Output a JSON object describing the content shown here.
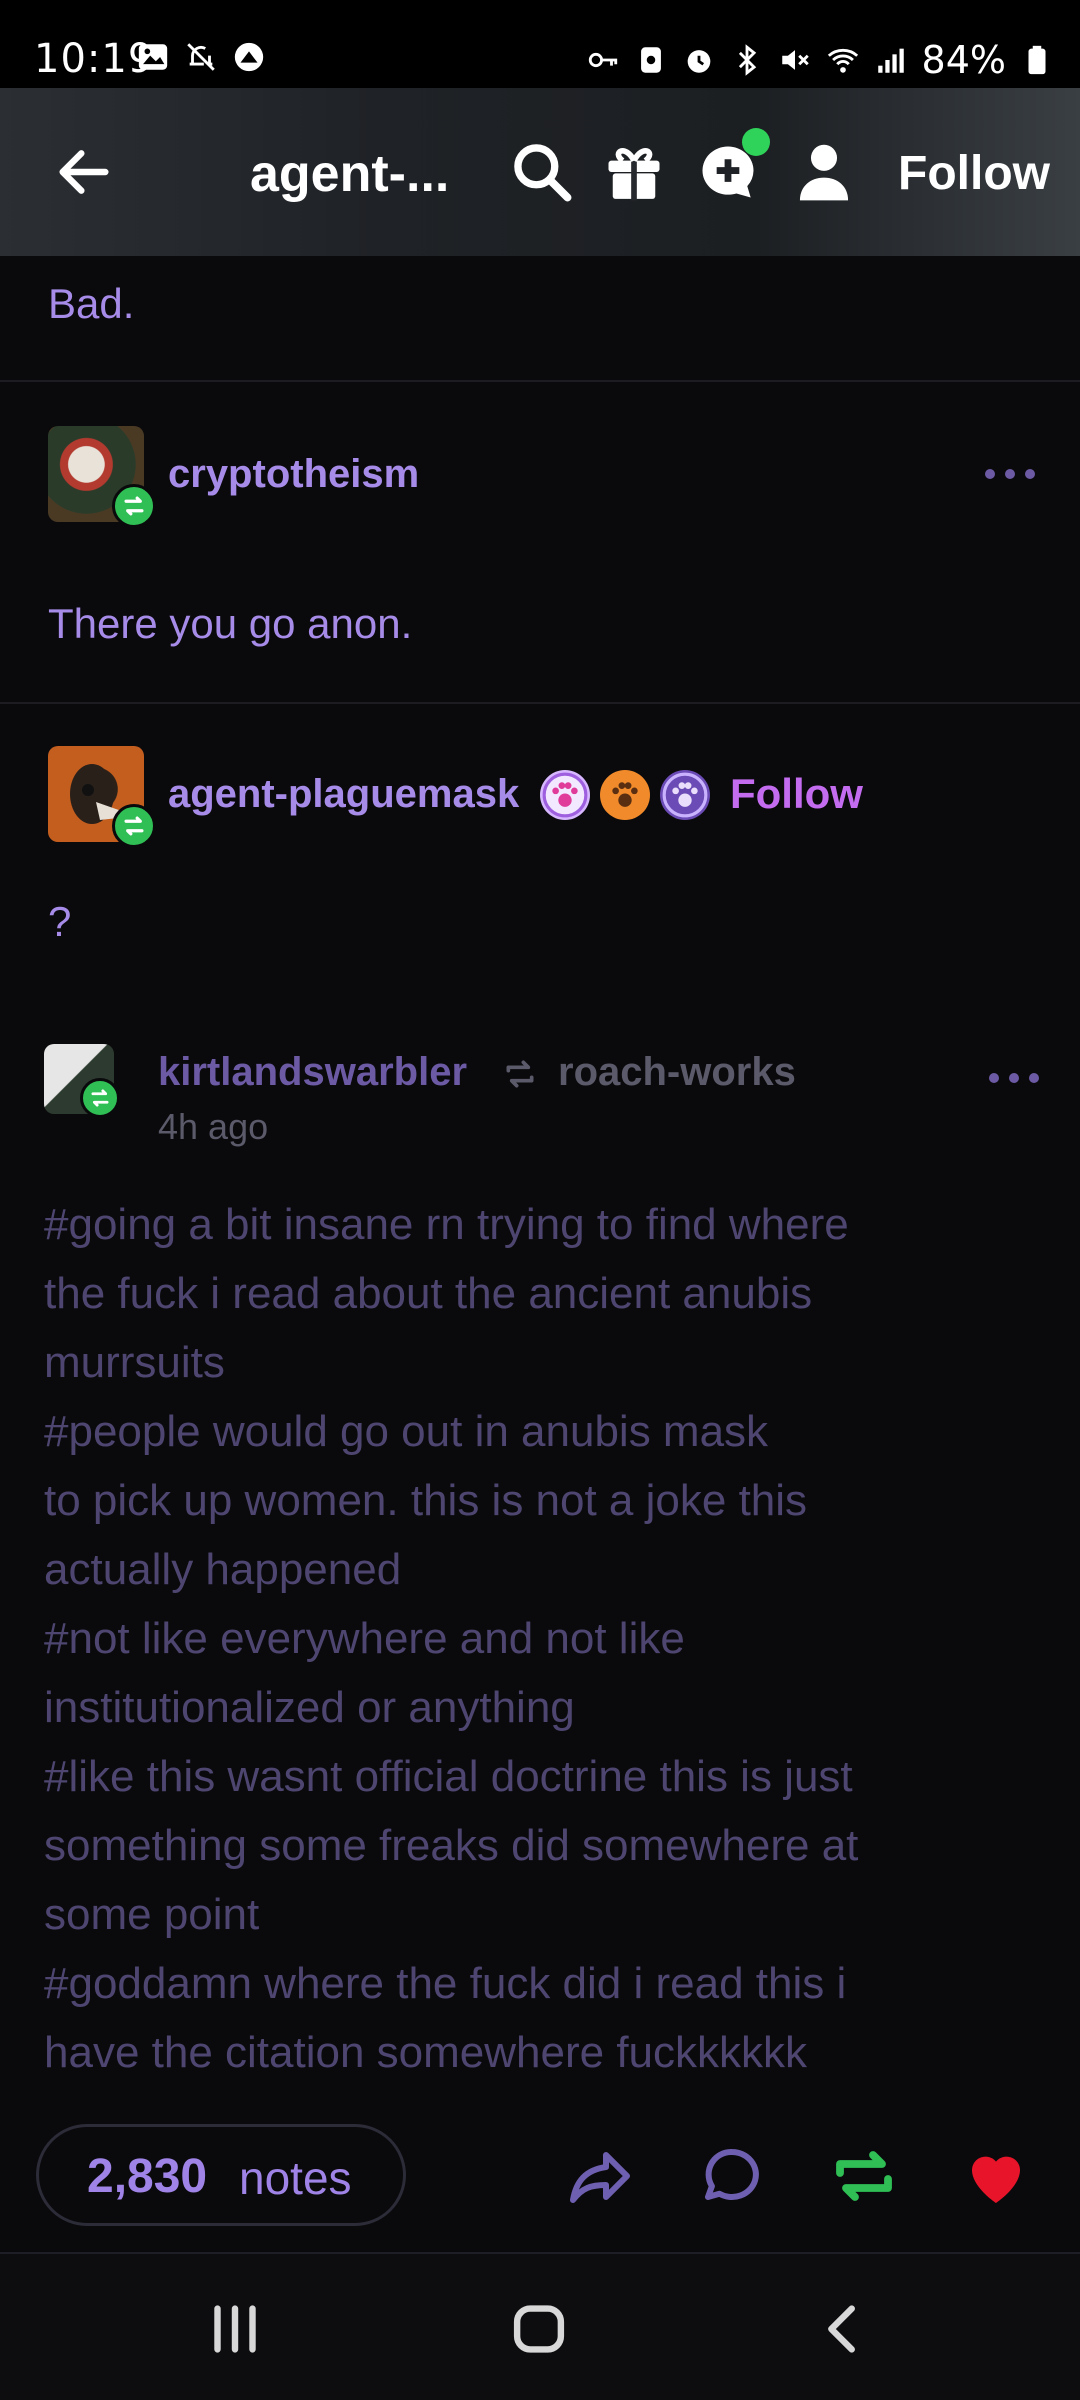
{
  "status_bar": {
    "time": "10:19",
    "battery": "84%"
  },
  "header": {
    "title": "agent-...",
    "follow": "Follow"
  },
  "thread": {
    "prev_reply_text": "Bad.",
    "reply1": {
      "username": "cryptotheism",
      "text": "There you go anon."
    },
    "reply2": {
      "username": "agent-plaguemask",
      "follow": "Follow",
      "text": "?"
    }
  },
  "post": {
    "username": "kirtlandswarbler",
    "reblogged_from": "roach-works",
    "time": "4h ago",
    "tag_lines": [
      "#going a bit insane rn trying to find where",
      "the fuck i read about the ancient anubis",
      "murrsuits",
      "#people would go out in anubis mask",
      "to pick up women. this is not a joke this",
      "actually happened",
      "#not like everywhere and not like",
      "institutionalized or anything",
      "#like this wasnt official doctrine this is just",
      "something some freaks did somewhere at",
      "some point",
      "#goddamn where the fuck did i read this i",
      "have the citation somewhere fuckkkkkk"
    ]
  },
  "footer": {
    "notes_count": "2,830",
    "notes_label": "notes"
  },
  "colors": {
    "accent": "#a78be8",
    "reblog_green": "#2fbf55",
    "like_red": "#e8142a",
    "follow_purple": "#c46cf0"
  }
}
